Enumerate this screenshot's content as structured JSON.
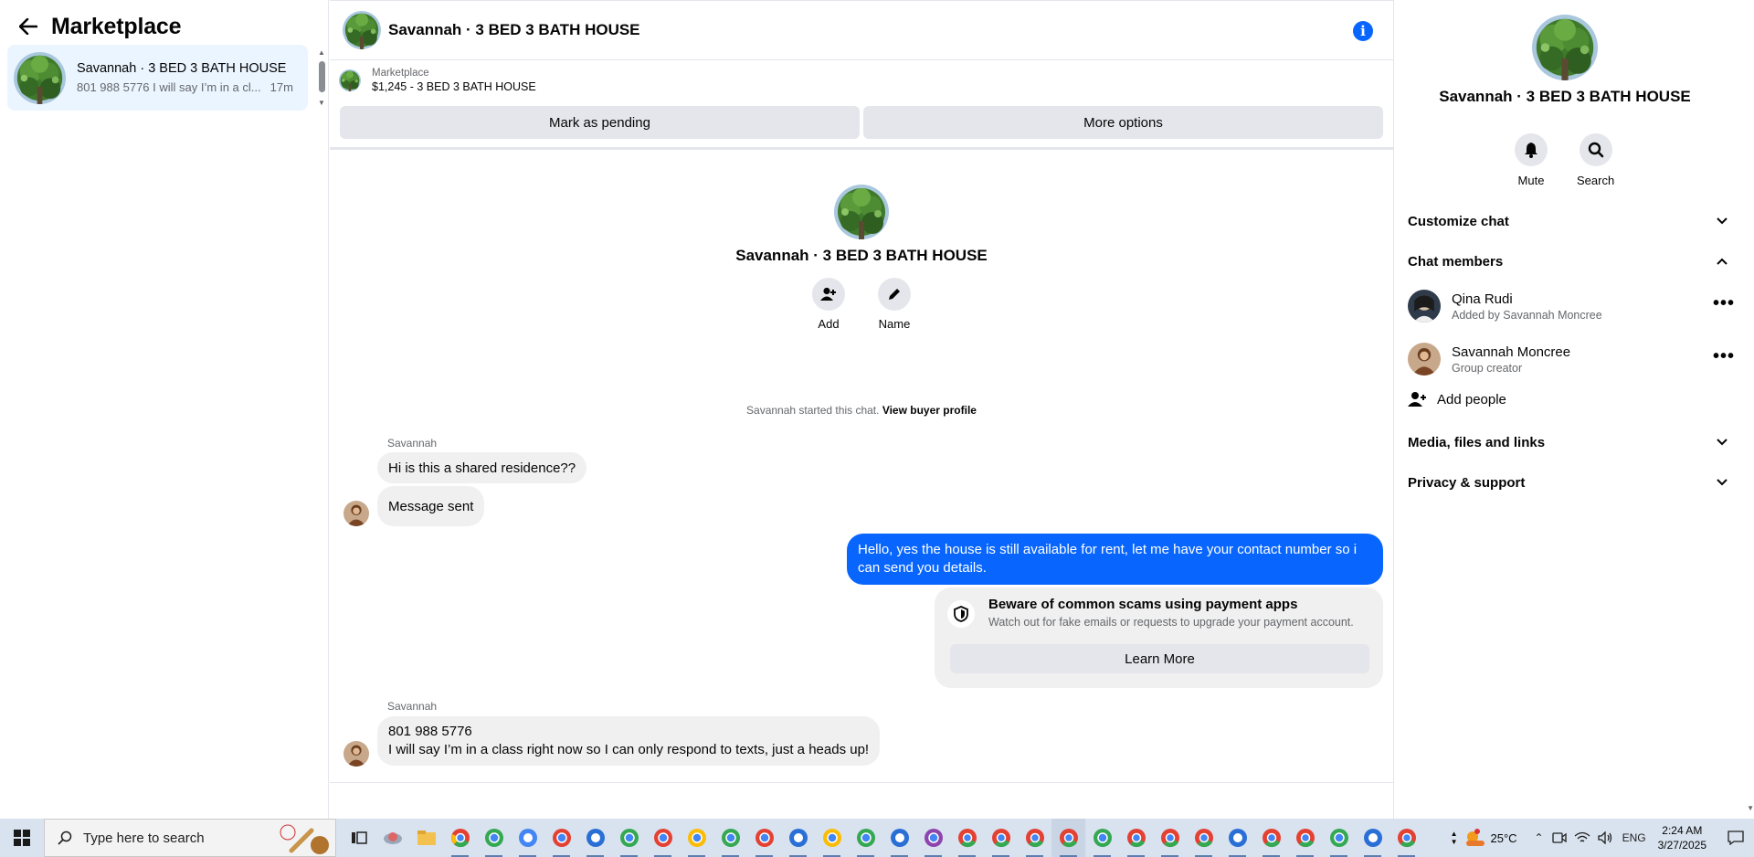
{
  "left": {
    "title": "Marketplace",
    "conversation": {
      "name": "Savannah · 3 BED 3 BATH HOUSE",
      "preview": "801 988 5776 I will say I’m in a cl...",
      "time": "17m"
    }
  },
  "chat": {
    "header_title": "Savannah · 3 BED 3 BATH HOUSE",
    "listing_label": "Marketplace",
    "listing_title": "$1,245 - 3 BED 3 BATH HOUSE",
    "mark_pending": "Mark as pending",
    "more_options": "More options",
    "intro_name": "Savannah · 3 BED 3 BATH HOUSE",
    "add_label": "Add",
    "name_label": "Name",
    "started_text": "Savannah started this chat.",
    "view_buyer": "View buyer profile",
    "sender1": "Savannah",
    "msg1": "Hi is this a shared residence??",
    "msg2": "Message sent",
    "out_msg_line1": "Hello, yes the house is still available for rent, let me have your contact number so i",
    "out_msg_line2": "can send you details.",
    "scam_title": "Beware of common scams using payment apps",
    "scam_text": "Watch out for fake emails or requests to upgrade your payment account.",
    "learn_more": "Learn More",
    "sender2": "Savannah",
    "msg3_line1": "801 988 5776",
    "msg3_line2": "I will say I’m in a class right now so I can only respond to texts, just a heads up!"
  },
  "right": {
    "name": "Savannah · 3 BED 3 BATH HOUSE",
    "mute": "Mute",
    "search": "Search",
    "customize": "Customize chat",
    "members": "Chat members",
    "member1_name": "Qina Rudi",
    "member1_sub": "Added by Savannah Moncree",
    "member2_name": "Savannah Moncree",
    "member2_sub": "Group creator",
    "add_people": "Add people",
    "media": "Media, files and links",
    "privacy": "Privacy & support"
  },
  "taskbar": {
    "search_placeholder": "Type here to search",
    "temperature": "25°C",
    "lang": "ENG",
    "time": "2:24 AM",
    "date": "3/27/2025"
  },
  "colors": {
    "accent": "#0866ff",
    "bubble_gray": "#f0f0f0",
    "selected": "#ebf5ff"
  }
}
